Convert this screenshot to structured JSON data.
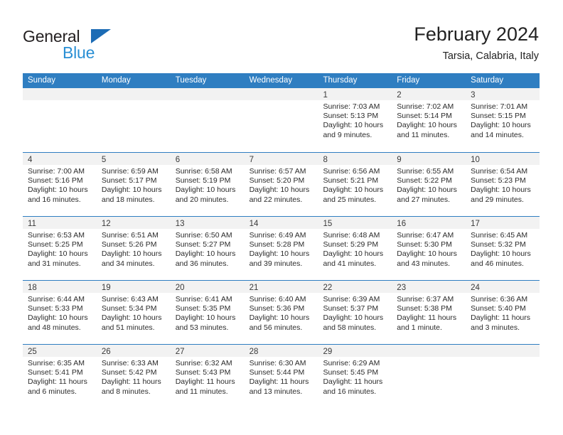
{
  "brand": {
    "name_part1": "General",
    "name_part2": "Blue",
    "logo_icon": "triangle-flag-icon"
  },
  "header": {
    "title": "February 2024",
    "location": "Tarsia, Calabria, Italy"
  },
  "colors": {
    "header_blue": "#2f7ec1",
    "brand_dark": "#231f20",
    "brand_blue": "#2a8fd4",
    "daynum_band": "#f2f2f2",
    "text": "#2b2b2b"
  },
  "weekdays": [
    "Sunday",
    "Monday",
    "Tuesday",
    "Wednesday",
    "Thursday",
    "Friday",
    "Saturday"
  ],
  "weeks": [
    [
      {
        "day": "",
        "lines": []
      },
      {
        "day": "",
        "lines": []
      },
      {
        "day": "",
        "lines": []
      },
      {
        "day": "",
        "lines": []
      },
      {
        "day": "1",
        "lines": [
          "Sunrise: 7:03 AM",
          "Sunset: 5:13 PM",
          "Daylight: 10 hours",
          "and 9 minutes."
        ]
      },
      {
        "day": "2",
        "lines": [
          "Sunrise: 7:02 AM",
          "Sunset: 5:14 PM",
          "Daylight: 10 hours",
          "and 11 minutes."
        ]
      },
      {
        "day": "3",
        "lines": [
          "Sunrise: 7:01 AM",
          "Sunset: 5:15 PM",
          "Daylight: 10 hours",
          "and 14 minutes."
        ]
      }
    ],
    [
      {
        "day": "4",
        "lines": [
          "Sunrise: 7:00 AM",
          "Sunset: 5:16 PM",
          "Daylight: 10 hours",
          "and 16 minutes."
        ]
      },
      {
        "day": "5",
        "lines": [
          "Sunrise: 6:59 AM",
          "Sunset: 5:17 PM",
          "Daylight: 10 hours",
          "and 18 minutes."
        ]
      },
      {
        "day": "6",
        "lines": [
          "Sunrise: 6:58 AM",
          "Sunset: 5:19 PM",
          "Daylight: 10 hours",
          "and 20 minutes."
        ]
      },
      {
        "day": "7",
        "lines": [
          "Sunrise: 6:57 AM",
          "Sunset: 5:20 PM",
          "Daylight: 10 hours",
          "and 22 minutes."
        ]
      },
      {
        "day": "8",
        "lines": [
          "Sunrise: 6:56 AM",
          "Sunset: 5:21 PM",
          "Daylight: 10 hours",
          "and 25 minutes."
        ]
      },
      {
        "day": "9",
        "lines": [
          "Sunrise: 6:55 AM",
          "Sunset: 5:22 PM",
          "Daylight: 10 hours",
          "and 27 minutes."
        ]
      },
      {
        "day": "10",
        "lines": [
          "Sunrise: 6:54 AM",
          "Sunset: 5:23 PM",
          "Daylight: 10 hours",
          "and 29 minutes."
        ]
      }
    ],
    [
      {
        "day": "11",
        "lines": [
          "Sunrise: 6:53 AM",
          "Sunset: 5:25 PM",
          "Daylight: 10 hours",
          "and 31 minutes."
        ]
      },
      {
        "day": "12",
        "lines": [
          "Sunrise: 6:51 AM",
          "Sunset: 5:26 PM",
          "Daylight: 10 hours",
          "and 34 minutes."
        ]
      },
      {
        "day": "13",
        "lines": [
          "Sunrise: 6:50 AM",
          "Sunset: 5:27 PM",
          "Daylight: 10 hours",
          "and 36 minutes."
        ]
      },
      {
        "day": "14",
        "lines": [
          "Sunrise: 6:49 AM",
          "Sunset: 5:28 PM",
          "Daylight: 10 hours",
          "and 39 minutes."
        ]
      },
      {
        "day": "15",
        "lines": [
          "Sunrise: 6:48 AM",
          "Sunset: 5:29 PM",
          "Daylight: 10 hours",
          "and 41 minutes."
        ]
      },
      {
        "day": "16",
        "lines": [
          "Sunrise: 6:47 AM",
          "Sunset: 5:30 PM",
          "Daylight: 10 hours",
          "and 43 minutes."
        ]
      },
      {
        "day": "17",
        "lines": [
          "Sunrise: 6:45 AM",
          "Sunset: 5:32 PM",
          "Daylight: 10 hours",
          "and 46 minutes."
        ]
      }
    ],
    [
      {
        "day": "18",
        "lines": [
          "Sunrise: 6:44 AM",
          "Sunset: 5:33 PM",
          "Daylight: 10 hours",
          "and 48 minutes."
        ]
      },
      {
        "day": "19",
        "lines": [
          "Sunrise: 6:43 AM",
          "Sunset: 5:34 PM",
          "Daylight: 10 hours",
          "and 51 minutes."
        ]
      },
      {
        "day": "20",
        "lines": [
          "Sunrise: 6:41 AM",
          "Sunset: 5:35 PM",
          "Daylight: 10 hours",
          "and 53 minutes."
        ]
      },
      {
        "day": "21",
        "lines": [
          "Sunrise: 6:40 AM",
          "Sunset: 5:36 PM",
          "Daylight: 10 hours",
          "and 56 minutes."
        ]
      },
      {
        "day": "22",
        "lines": [
          "Sunrise: 6:39 AM",
          "Sunset: 5:37 PM",
          "Daylight: 10 hours",
          "and 58 minutes."
        ]
      },
      {
        "day": "23",
        "lines": [
          "Sunrise: 6:37 AM",
          "Sunset: 5:38 PM",
          "Daylight: 11 hours",
          "and 1 minute."
        ]
      },
      {
        "day": "24",
        "lines": [
          "Sunrise: 6:36 AM",
          "Sunset: 5:40 PM",
          "Daylight: 11 hours",
          "and 3 minutes."
        ]
      }
    ],
    [
      {
        "day": "25",
        "lines": [
          "Sunrise: 6:35 AM",
          "Sunset: 5:41 PM",
          "Daylight: 11 hours",
          "and 6 minutes."
        ]
      },
      {
        "day": "26",
        "lines": [
          "Sunrise: 6:33 AM",
          "Sunset: 5:42 PM",
          "Daylight: 11 hours",
          "and 8 minutes."
        ]
      },
      {
        "day": "27",
        "lines": [
          "Sunrise: 6:32 AM",
          "Sunset: 5:43 PM",
          "Daylight: 11 hours",
          "and 11 minutes."
        ]
      },
      {
        "day": "28",
        "lines": [
          "Sunrise: 6:30 AM",
          "Sunset: 5:44 PM",
          "Daylight: 11 hours",
          "and 13 minutes."
        ]
      },
      {
        "day": "29",
        "lines": [
          "Sunrise: 6:29 AM",
          "Sunset: 5:45 PM",
          "Daylight: 11 hours",
          "and 16 minutes."
        ]
      },
      {
        "day": "",
        "lines": []
      },
      {
        "day": "",
        "lines": []
      }
    ]
  ]
}
